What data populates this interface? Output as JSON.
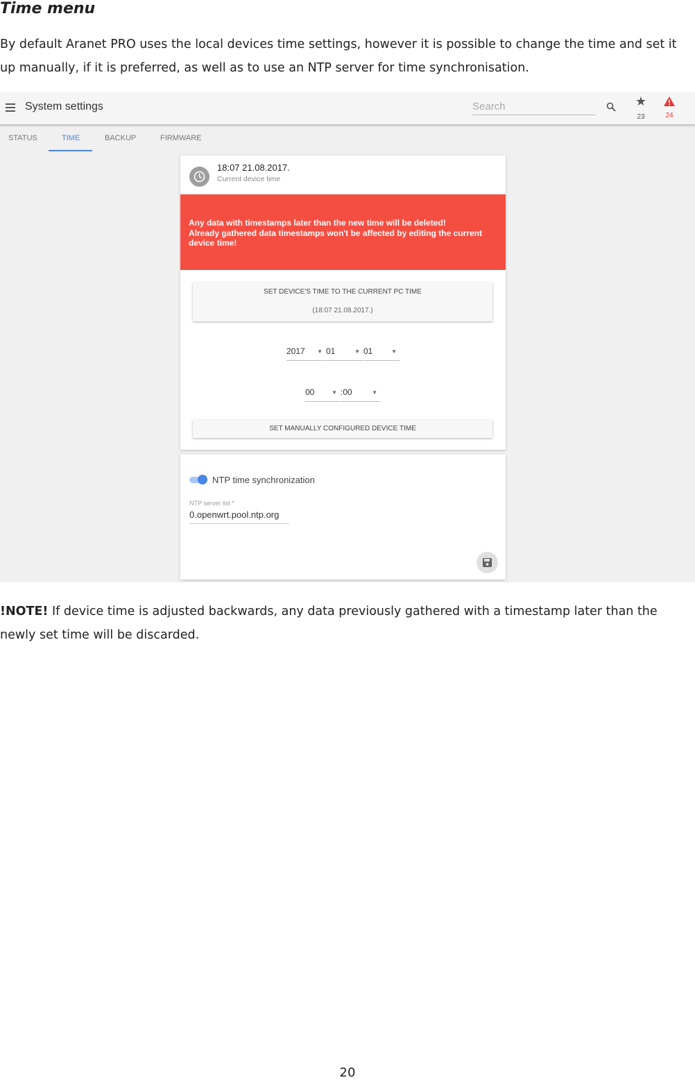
{
  "document": {
    "heading": "Time menu",
    "intro": "By default Aranet PRO uses the local devices time settings, however it is possible to change the time and set it up manually, if it is preferred, as well as to use an NTP server for time synchronisation.",
    "note_label": "!NOTE!",
    "note_text": " If device time is adjusted backwards, any data previously gathered with a timestamp later than the newly set time will be discarded.",
    "page_number": "20"
  },
  "app": {
    "title": "System settings",
    "search_placeholder": "Search",
    "star_count": "23",
    "warning_count": "24",
    "accent_color": "#4a86e8",
    "alert_color": "#f44e42",
    "tabs": [
      {
        "label": "STATUS",
        "active": false
      },
      {
        "label": "TIME",
        "active": true
      },
      {
        "label": "BACKUP",
        "active": false
      },
      {
        "label": "FIRMWARE",
        "active": false
      }
    ]
  },
  "time_card": {
    "current_time": "18:07 21.08.2017.",
    "current_time_label": "Current device time",
    "alert_line1": "Any data with timestamps later than the new time will be deleted!",
    "alert_line2": "Already gathered data timestamps won't be affected by editing the current device time!",
    "set_pc_time_label": "SET DEVICE'S TIME TO THE CURRENT PC TIME",
    "set_pc_time_value": "(18:07 21.08.2017.)",
    "year": "2017",
    "month": "01",
    "day": "01",
    "hour": "00",
    "minute": ":00",
    "set_manual_label": "SET MANUALLY CONFIGURED DEVICE TIME"
  },
  "ntp_card": {
    "toggle_on": true,
    "toggle_label": "NTP time synchronization",
    "server_list_label": "NTP server list *",
    "server_list_value": "0.openwrt.pool.ntp.org",
    "save_icon": "floppy-disk-icon"
  }
}
